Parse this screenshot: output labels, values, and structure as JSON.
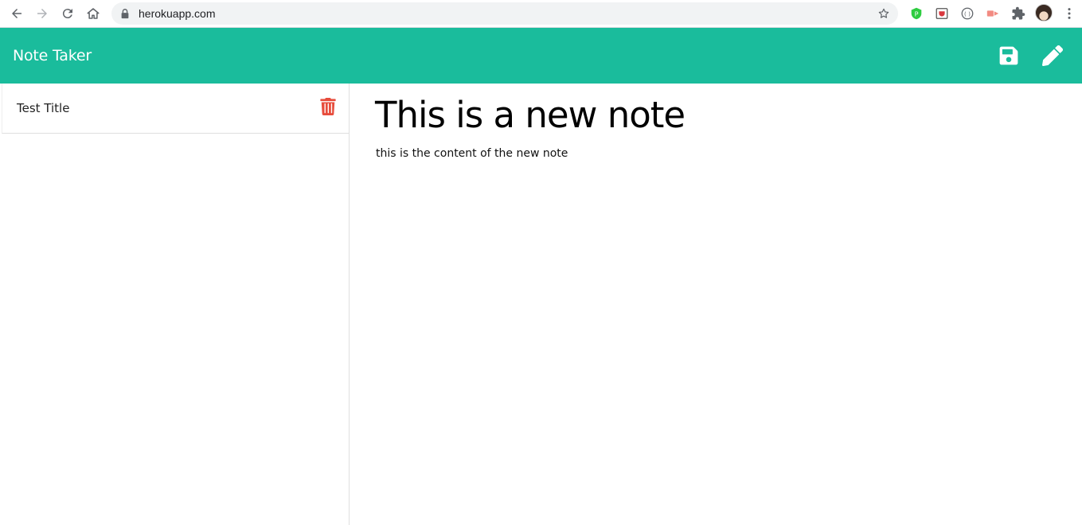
{
  "browser": {
    "url": "herokuapp.com"
  },
  "navbar": {
    "brand": "Note Taker",
    "accent_color": "#1abc9c",
    "actions": [
      {
        "icon": "save-icon"
      },
      {
        "icon": "pencil-icon"
      }
    ]
  },
  "sidebar": {
    "notes": [
      {
        "title": "Test Title",
        "delete_icon": "trash-icon",
        "delete_color": "#e74c3c"
      }
    ]
  },
  "editor": {
    "title": "This is a new note",
    "text": "this is the content of the new note"
  }
}
